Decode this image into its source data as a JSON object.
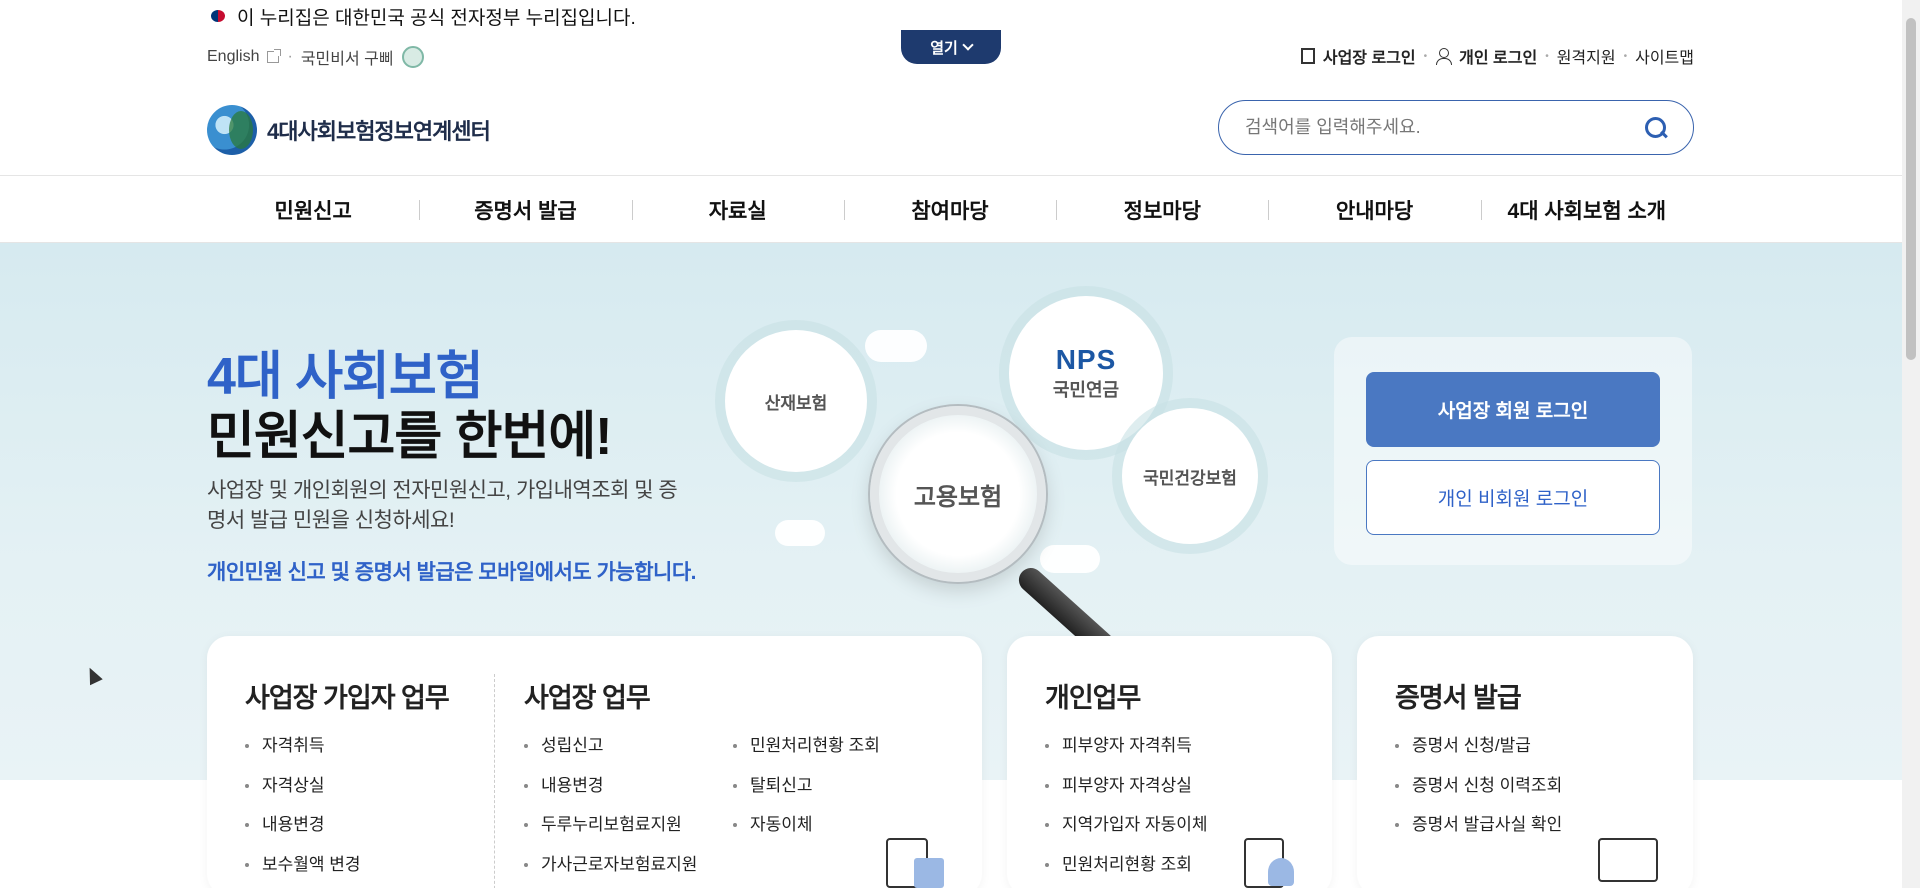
{
  "gov_banner": "이 누리집은 대한민국 공식 전자정부 누리집입니다.",
  "open_tab": "열기",
  "util_left": {
    "english": "English",
    "assistant": "국민비서 구삐"
  },
  "util_right": {
    "biz_login": "사업장 로그인",
    "personal_login": "개인 로그인",
    "remote": "원격지원",
    "sitemap": "사이트맵"
  },
  "logo_text": "4대사회보험정보연계센터",
  "search": {
    "placeholder": "검색어를 입력해주세요."
  },
  "gnb": [
    "민원신고",
    "증명서 발급",
    "자료실",
    "참여마당",
    "정보마당",
    "안내마당",
    "4대 사회보험 소개"
  ],
  "hero": {
    "title1": "4대 사회보험",
    "title2": "민원신고를 한번에!",
    "desc": "사업장 및 개인회원의 전자민원신고, 가입내역조회 및 증명서 발급 민원을 신청하세요!",
    "mobile": "개인민원 신고 및 증명서 발급은 모바일에서도 가능합니다.",
    "badges": {
      "industrial": "산재보험",
      "nps": "NPS",
      "pension": "국민연금",
      "health": "국민건강보험",
      "employment": "고용보험"
    }
  },
  "login": {
    "biz_member": "사업장 회원 로그인",
    "personal_guest": "개인 비회원 로그인"
  },
  "cards": {
    "biz_subscriber": {
      "title": "사업장 가입자 업무",
      "items": [
        "자격취득",
        "자격상실",
        "내용변경",
        "보수월액 변경"
      ]
    },
    "biz_work": {
      "title": "사업장 업무",
      "col1": [
        "성립신고",
        "내용변경",
        "두루누리보험료지원",
        "가사근로자보험료지원"
      ],
      "col2": [
        "민원처리현황 조회",
        "탈퇴신고",
        "자동이체"
      ]
    },
    "personal": {
      "title": "개인업무",
      "items": [
        "피부양자 자격취득",
        "피부양자 자격상실",
        "지역가입자 자동이체",
        "민원처리현황 조회"
      ]
    },
    "certificate": {
      "title": "증명서 발급",
      "items": [
        "증명서 신청/발급",
        "증명서 신청 이력조회",
        "증명서 발급사실 확인"
      ]
    }
  }
}
